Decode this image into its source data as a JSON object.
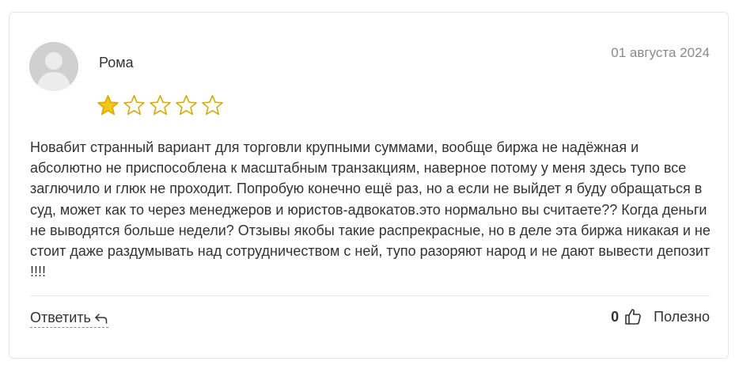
{
  "review": {
    "author": "Рома",
    "date": "01 августа 2024",
    "rating": 1,
    "max_rating": 5,
    "text": "Новабит странный вариант для торговли крупными суммами, вообще биржа не надёжная и абсолютно не приспособлена к масштабным транзакциям, наверное потому у меня здесь тупо все заглючило и глюк не проходит. Попробую конечно ещё раз, но а если не выйдет я буду обращаться в суд, может как то через менеджеров и юристов-адвокатов.это нормально вы считаете?? Когда деньги не выводятся больше недели? Отзывы якобы такие распрекрасные, но в деле эта биржа никакая и не стоит даже раздумывать над сотрудничеством с ней, тупо разоряют народ и не дают вывести депозит !!!!"
  },
  "actions": {
    "reply_label": "Ответить",
    "like_count": "0",
    "useful_label": "Полезно"
  },
  "colors": {
    "star_fill": "#f5c518",
    "star_outline": "#d9a900",
    "text": "#333333",
    "date": "#8a8a8a"
  },
  "icons": {
    "avatar": "user-avatar-placeholder",
    "reply": "reply-arrow-icon",
    "like": "thumbs-up-icon",
    "star_filled": "star-filled-icon",
    "star_empty": "star-outline-icon"
  }
}
